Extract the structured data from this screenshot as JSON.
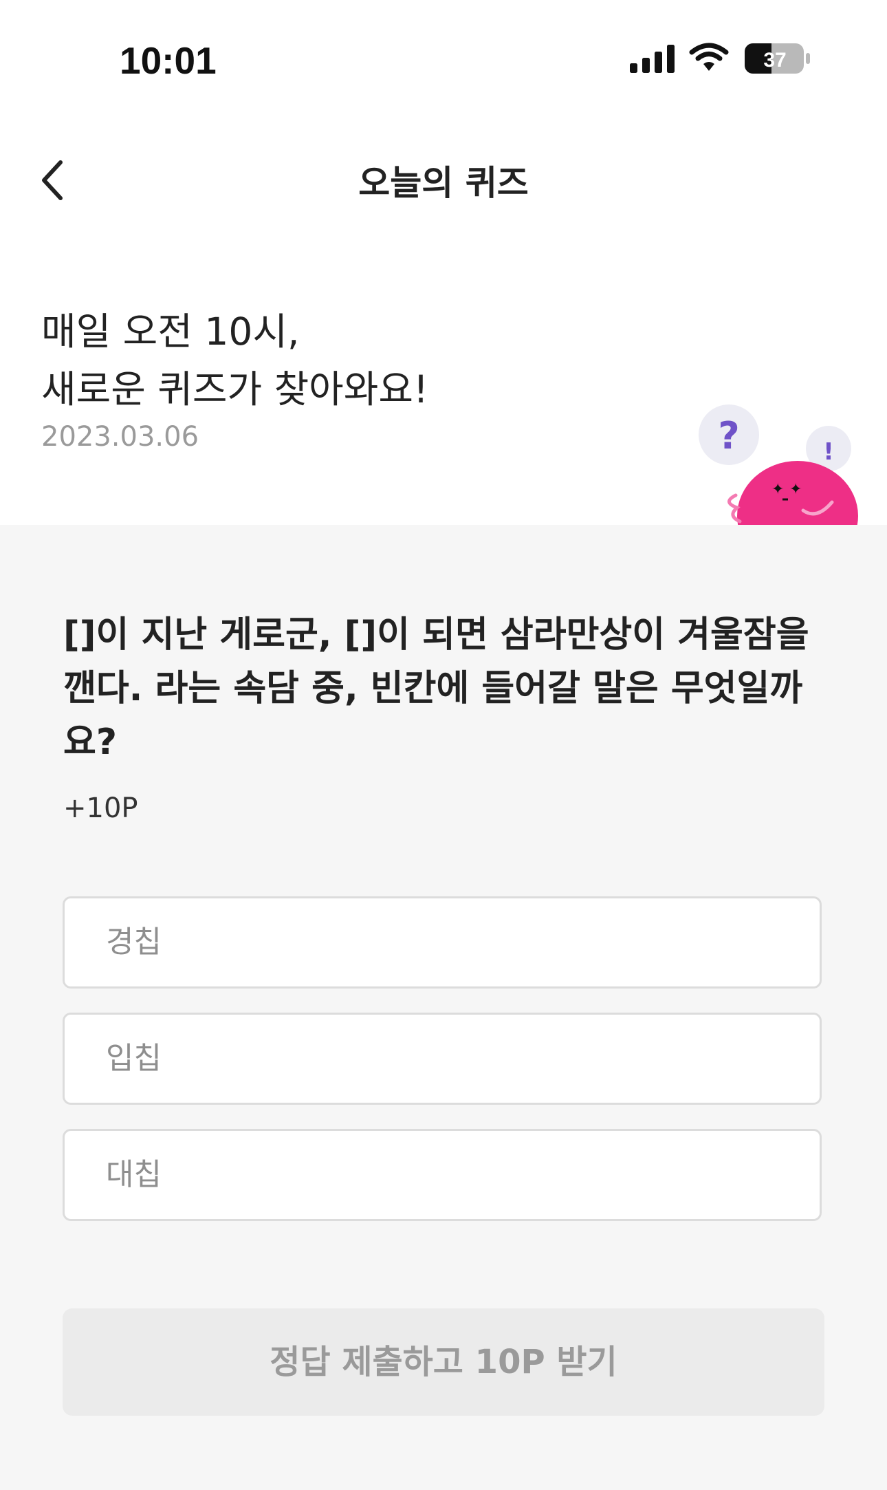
{
  "status_bar": {
    "time": "10:01",
    "battery_level": "37",
    "icons": [
      "cellular-signal-icon",
      "wifi-icon",
      "battery-icon"
    ]
  },
  "nav": {
    "back_icon": "chevron-left-icon",
    "title": "오늘의 퀴즈"
  },
  "hero": {
    "headline_line1": "매일 오전 10시,",
    "headline_line2": "새로운 퀴즈가 찾아와요!",
    "date": "2023.03.06",
    "mascot_icon": "quiz-mascot-icon"
  },
  "quiz": {
    "question_line1": "[]이 지난 게로군, []이 되면 삼라만상이 겨울잠을",
    "question_line2": "깬다. 라는 속담 중, 빈칸에 들어갈 말은 무엇일까",
    "question_line3": "요?",
    "points": "+10P",
    "options": [
      {
        "label": "경칩"
      },
      {
        "label": "입칩"
      },
      {
        "label": "대칩"
      }
    ],
    "submit_label": "정답 제출하고 10P 받기"
  },
  "colors": {
    "background": "#f6f6f6",
    "card": "#ffffff",
    "mascot_pink": "#ee2f86",
    "accent_purple": "#7b5ccf",
    "button_disabled": "#ebebeb"
  }
}
